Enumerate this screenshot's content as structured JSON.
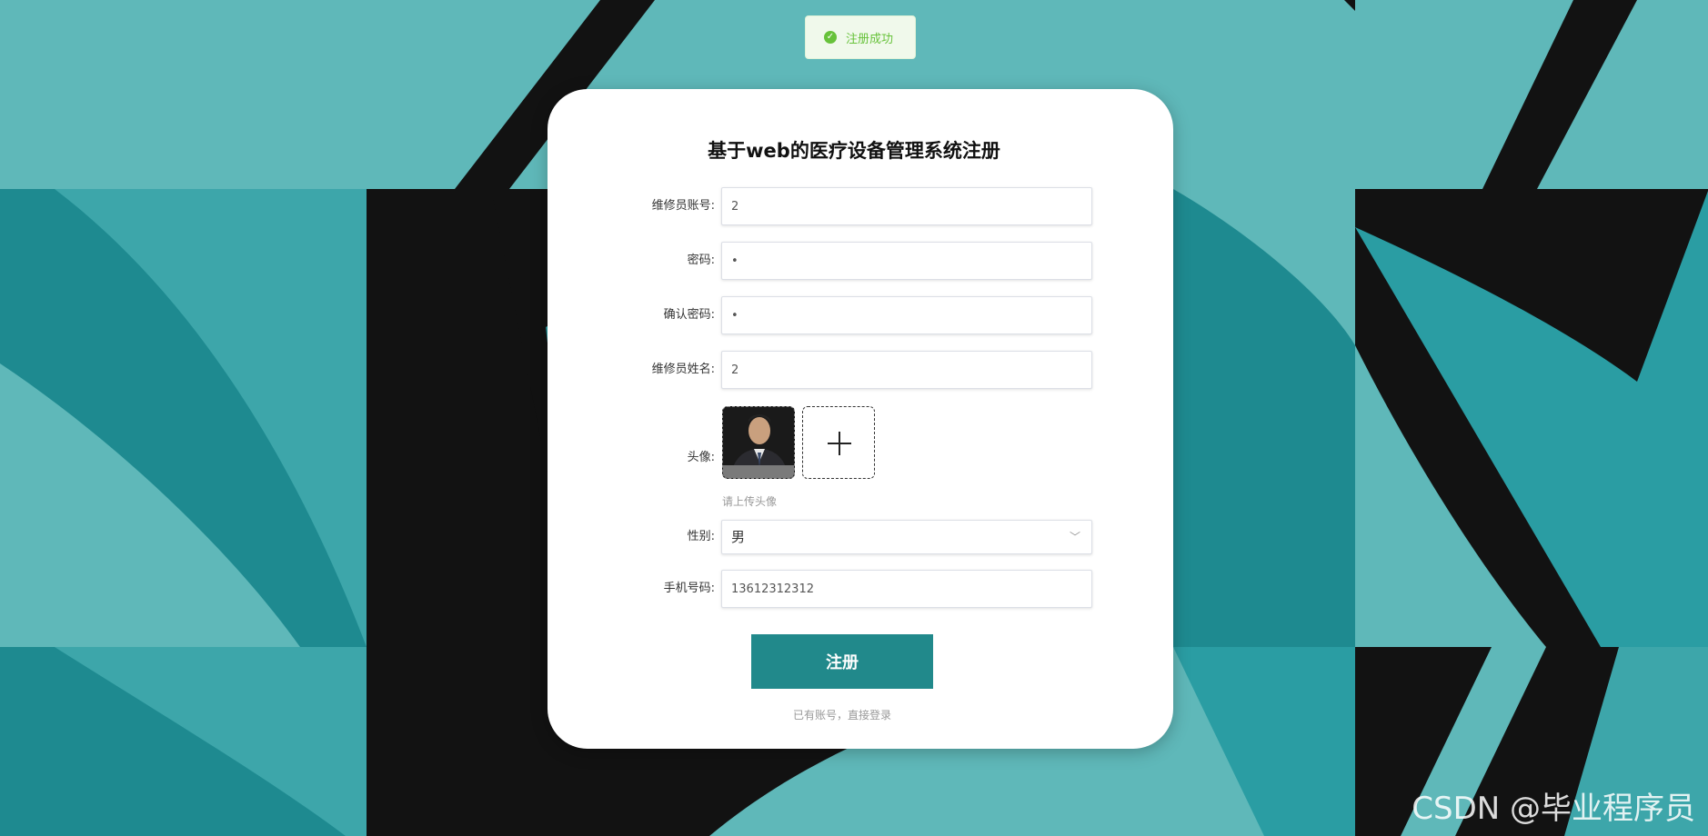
{
  "colors": {
    "teal_light": "#5fb8b9",
    "teal_mid": "#3da6aa",
    "teal_dark": "#1e8a90",
    "black_band": "#121212",
    "button": "#21898b",
    "success": "#67c23a"
  },
  "toast": {
    "icon": "check-circle-icon",
    "message": "注册成功"
  },
  "title": "基于web的医疗设备管理系统注册",
  "form": {
    "account": {
      "label": "维修员账号:",
      "value": "2"
    },
    "password": {
      "label": "密码:",
      "value": "•"
    },
    "confirm_password": {
      "label": "确认密码:",
      "value": "•"
    },
    "name": {
      "label": "维修员姓名:",
      "value": "2"
    },
    "avatar": {
      "label": "头像:",
      "hint": "请上传头像",
      "upload_icon": "plus-icon"
    },
    "gender": {
      "label": "性别:",
      "value": "男",
      "icon": "chevron-down-icon"
    },
    "phone": {
      "label": "手机号码:",
      "value": "13612312312"
    }
  },
  "submit_label": "注册",
  "login_link": "已有账号，直接登录",
  "watermark": "CSDN @毕业程序员"
}
